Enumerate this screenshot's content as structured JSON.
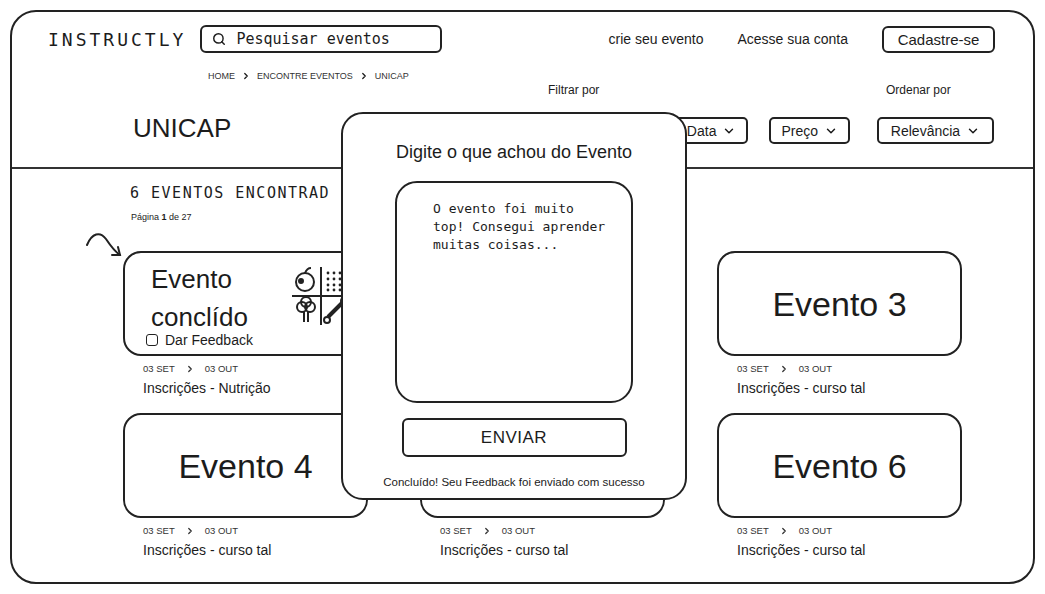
{
  "header": {
    "logo": "INSTRUCTLY",
    "search": {
      "placeholder": "Pesquisar eventos"
    },
    "nav": [
      "crie seu evento",
      "Acesse sua conta"
    ],
    "signup_button": "Cadastre-se"
  },
  "breadcrumb": [
    "HOME",
    "ENCONTRE EVENTOS",
    "UNICAP"
  ],
  "page_title": "UNICAP",
  "filter": {
    "label": "Filtrar por",
    "options": [
      "Data",
      "Preço"
    ]
  },
  "sort": {
    "label": "Ordenar por",
    "value": "Relevância"
  },
  "results": {
    "count": "6 EVENTOS ENCONTRAD",
    "page": {
      "prefix": "Página",
      "current": "1",
      "suffix": "de 27"
    }
  },
  "events": [
    {
      "kind": "completed",
      "title": "Evento conclído",
      "feedback": {
        "label": "Dar Feedback",
        "checked": false
      },
      "start": "03 SET",
      "end": "03 OUT",
      "caption": "Inscrições - Nutrição"
    },
    {
      "kind": "plain"
    },
    {
      "kind": "plain",
      "title": "Evento 3",
      "start": "03 SET",
      "end": "03 OUT",
      "caption": "Inscrições - curso tal"
    },
    {
      "kind": "plain",
      "title": "Evento 4",
      "start": "03 SET",
      "end": "03 OUT",
      "caption": "Inscrições - curso tal"
    },
    {
      "kind": "plain",
      "start": "03 SET",
      "end": "03 OUT",
      "caption": "Inscrições - curso tal"
    },
    {
      "kind": "plain",
      "title": "Evento 6",
      "start": "03 SET",
      "end": "03 OUT",
      "caption": "Inscrições - curso tal"
    }
  ],
  "feedback_dialog": {
    "title": "Digite o que achou do Evento",
    "text": "O evento foi muito top! Consegui aprender muitas coisas...",
    "button": "ENVIAR",
    "status": "Concluído! Seu Feedback foi enviado com sucesso"
  }
}
